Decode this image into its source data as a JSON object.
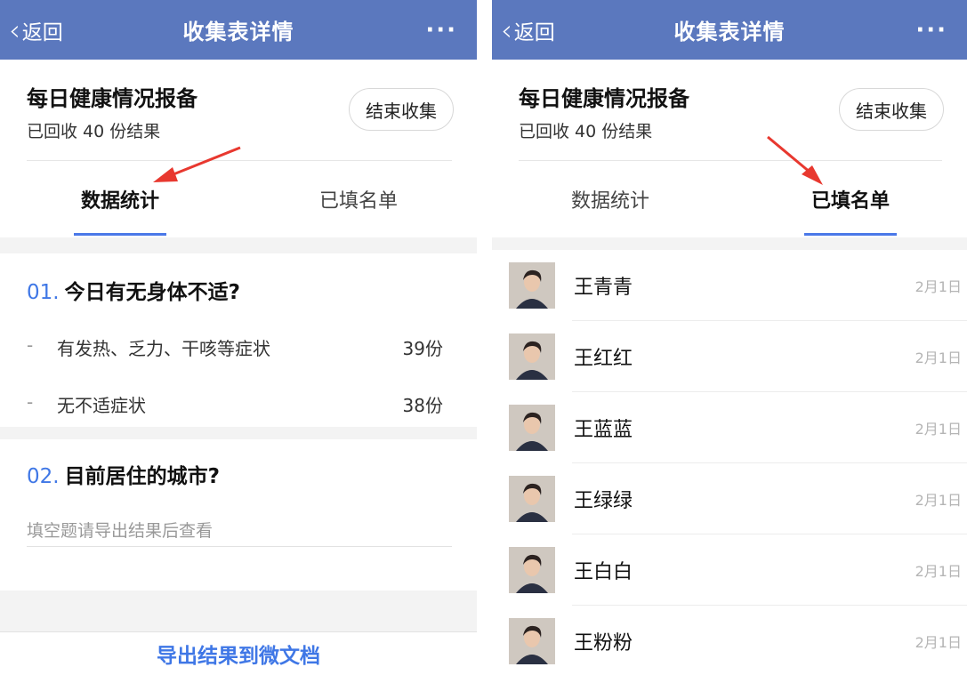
{
  "nav": {
    "back_label": "返回",
    "title": "收集表详情",
    "more_label": "···"
  },
  "form": {
    "title": "每日健康情况报备",
    "count_text": "已回收 40 份结果",
    "end_button": "结束收集"
  },
  "tabs": {
    "stats": "数据统计",
    "list": "已填名单"
  },
  "questions": [
    {
      "number": "01.",
      "title": "今日有无身体不适?",
      "options": [
        {
          "dash": "-",
          "label": "有发热、乏力、干咳等症状",
          "count": "39份"
        },
        {
          "dash": "-",
          "label": "无不适症状",
          "count": "38份"
        }
      ]
    },
    {
      "number": "02.",
      "title": "目前居住的城市?",
      "hint": "填空题请导出结果后查看"
    }
  ],
  "export_label": "导出结果到微文档",
  "respondents": [
    {
      "name": "王青青",
      "date": "2月1日"
    },
    {
      "name": "王红红",
      "date": "2月1日"
    },
    {
      "name": "王蓝蓝",
      "date": "2月1日"
    },
    {
      "name": "王绿绿",
      "date": "2月1日"
    },
    {
      "name": "王白白",
      "date": "2月1日"
    },
    {
      "name": "王粉粉",
      "date": "2月1日"
    }
  ],
  "colors": {
    "nav_bg": "#5b78be",
    "accent": "#3f77e6",
    "annotation_arrow": "#e8382f"
  }
}
